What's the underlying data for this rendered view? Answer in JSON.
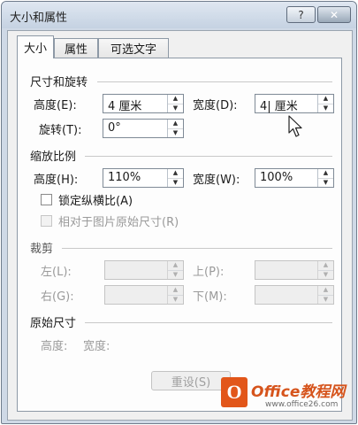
{
  "window": {
    "title": "大小和属性",
    "help_button": "?",
    "close_button": "✕"
  },
  "tabs": [
    {
      "label": "大小",
      "active": true
    },
    {
      "label": "属性",
      "active": false
    },
    {
      "label": "可选文字",
      "active": false
    }
  ],
  "size_rotate": {
    "title": "尺寸和旋转",
    "height_label": "高度(E):",
    "height_value": "4 厘米",
    "width_label": "宽度(D):",
    "width_value": "4| 厘米",
    "rotation_label": "旋转(T):",
    "rotation_value": "0°"
  },
  "scale": {
    "title": "缩放比例",
    "height_label": "高度(H):",
    "height_value": "110%",
    "width_label": "宽度(W):",
    "width_value": "100%",
    "lock_aspect_label": "锁定纵横比(A)",
    "lock_aspect_checked": false,
    "relative_label": "相对于图片原始尺寸(R)",
    "relative_checked": false
  },
  "crop": {
    "title": "裁剪",
    "left_label": "左(L):",
    "right_label": "右(G):",
    "top_label": "上(P):",
    "bottom_label": "下(M):"
  },
  "original": {
    "title": "原始尺寸",
    "height_label": "高度:",
    "width_label": "宽度:",
    "reset_button": "重设(S)"
  },
  "watermark": {
    "logo_glyph": "O",
    "text": "Office教程网",
    "url": "www.office26.com"
  },
  "icons": {
    "spin_up": "▲",
    "spin_down": "▼"
  },
  "colors": {
    "watermark_orange": "#e2561a",
    "disabled_text": "#9a9a9a"
  }
}
